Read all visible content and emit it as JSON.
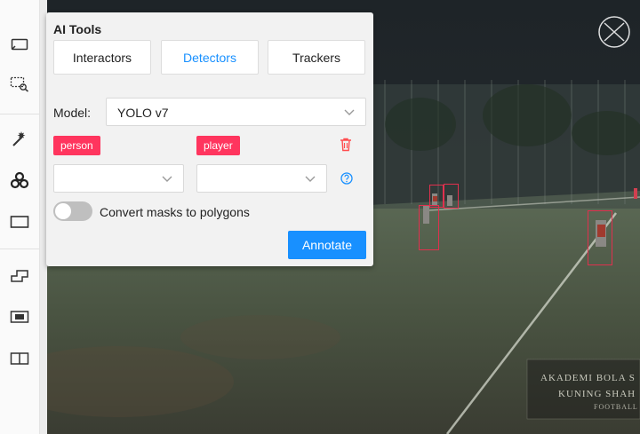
{
  "panel": {
    "title": "AI Tools",
    "tabs": [
      {
        "label": "Interactors",
        "active": false
      },
      {
        "label": "Detectors",
        "active": true
      },
      {
        "label": "Trackers",
        "active": false
      }
    ],
    "model_label": "Model:",
    "model_value": "YOLO v7",
    "mapping": {
      "model_label": "person",
      "task_label": "player"
    },
    "toggle": {
      "label": "Convert masks to polygons",
      "on": false
    },
    "annotate_label": "Annotate"
  },
  "toolbar": {
    "tools": [
      "cursor-icon",
      "zoom-region-icon",
      "magic-wand-icon",
      "openvino-icon",
      "rectangle-icon",
      "group-icon",
      "track-icon",
      "split-icon"
    ]
  },
  "colors": {
    "accent": "#1890ff",
    "label_tag": "#ff355e",
    "bbox": "#e0304e",
    "delete": "#ff4d4f"
  },
  "watermark": {
    "line1": "AKADEMI BOLA S",
    "line2": "KUNING SHAH",
    "line3": "FOOTBALL"
  }
}
